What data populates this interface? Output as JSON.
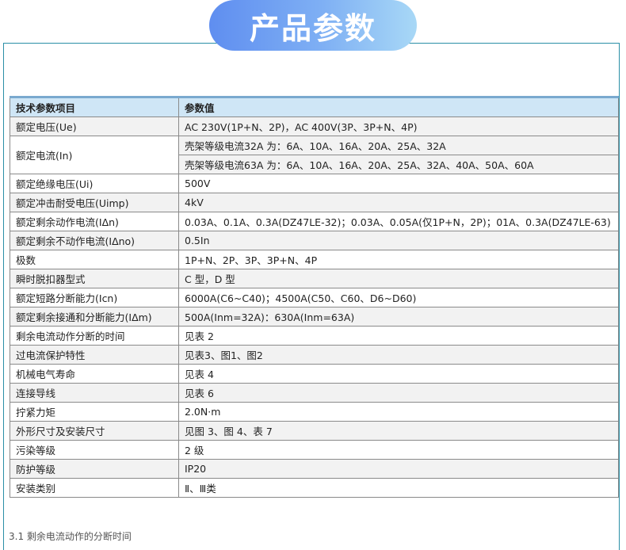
{
  "title": "产品参数",
  "table": {
    "headers": [
      "技术参数项目",
      "参数值"
    ],
    "rows": [
      {
        "name": "额定电压(Ue)",
        "value": "AC 230V(1P+N、2P)，AC 400V(3P、3P+N、4P)"
      },
      {
        "name": "额定电流(In)",
        "values": [
          "壳架等级电流32A 为：6A、10A、16A、20A、25A、32A",
          "壳架等级电流63A 为：6A、10A、16A、20A、25A、32A、40A、50A、60A"
        ]
      },
      {
        "name": "额定绝缘电压(Ui)",
        "value": "500V"
      },
      {
        "name": "额定冲击耐受电压(Uimp)",
        "value": "4kV"
      },
      {
        "name": "额定剩余动作电流(IΔn)",
        "value": "0.03A、0.1A、0.3A(DZ47LE-32)；0.03A、0.05A(仅1P+N，2P)；01A、0.3A(DZ47LE-63)"
      },
      {
        "name": "额定剩余不动作电流(IΔno)",
        "value": "0.5In"
      },
      {
        "name": "极数",
        "value": "1P+N、2P、3P、3P+N、4P"
      },
      {
        "name": "瞬时脱扣器型式",
        "value": "C 型，D 型"
      },
      {
        "name": "额定短路分断能力(Icn)",
        "value": "6000A(C6~C40)；4500A(C50、C60、D6~D60)"
      },
      {
        "name": "额定剩余接通和分断能力(IΔm)",
        "value": "500A(Inm=32A)：630A(Inm=63A)"
      },
      {
        "name": "剩余电流动作分断的时间",
        "value": "见表 2"
      },
      {
        "name": "过电流保护特性",
        "value": "见表3、图1、图2"
      },
      {
        "name": "机械电气寿命",
        "value": "见表 4"
      },
      {
        "name": "连接导线",
        "value": "见表 6"
      },
      {
        "name": "拧紧力矩",
        "value": "2.0N·m"
      },
      {
        "name": "外形尺寸及安装尺寸",
        "value": "见图 3、图 4、表 7"
      },
      {
        "name": "污染等级",
        "value": "2 级"
      },
      {
        "name": "防护等级",
        "value": "IP20"
      },
      {
        "name": "安装类别",
        "value": "Ⅱ、Ⅲ类"
      }
    ]
  },
  "footnote": "3.1 剩余电流动作的分断时间"
}
